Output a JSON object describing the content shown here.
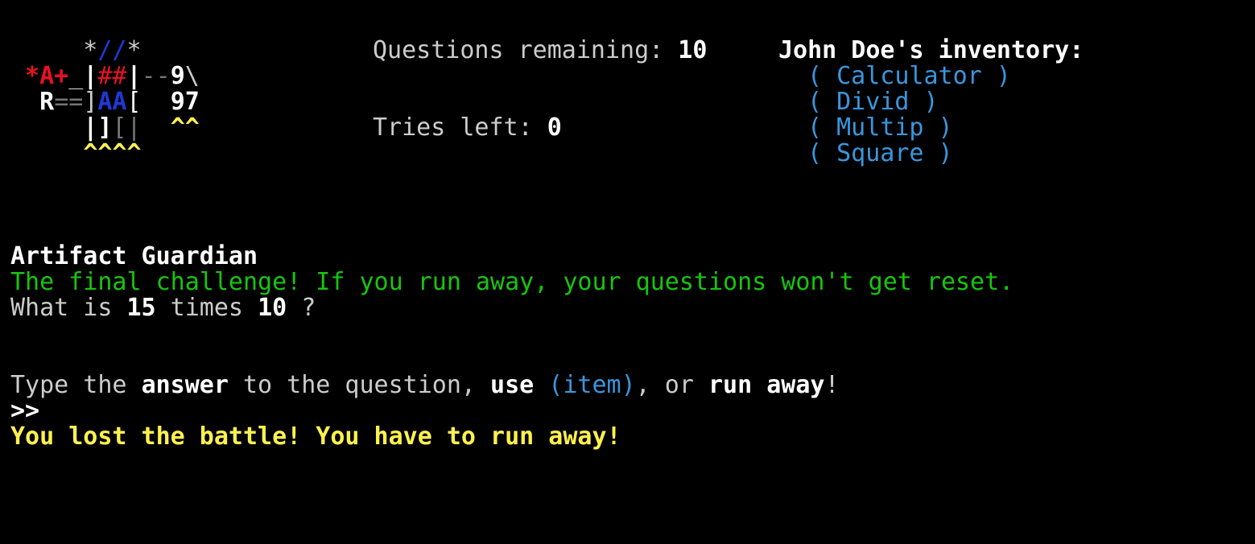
{
  "colors": {
    "background": "#000000",
    "default_text": "#cccccc",
    "bright_text": "#ffffff",
    "red": "#e81123",
    "blue": "#1f39d6",
    "cyan": "#3a96dd",
    "green": "#16c60c",
    "yellow": "#fff14d",
    "dark_grey": "#767676"
  },
  "ascii_art": {
    "row1": {
      "a": "     *",
      "b": "//",
      "c": "*"
    },
    "row2": {
      "a": " *A+",
      "b": "_",
      "c": "|",
      "d": "##",
      "e": "|",
      "f": "--",
      "g": "9",
      "h": "\\"
    },
    "row3": {
      "a": "  R",
      "b": "==",
      "c": "]",
      "d": "AA",
      "e": "[",
      "f": "  ",
      "g": "97"
    },
    "row4": {
      "a": "     ",
      "b": "|]",
      "c": "[|",
      "d": "  ",
      "e": "^^"
    },
    "row5": {
      "a": "     ",
      "b": "^^^^"
    }
  },
  "stats": {
    "questions_label": "Questions remaining: ",
    "questions_value": "10",
    "tries_label": "Tries left: ",
    "tries_value": "0"
  },
  "inventory": {
    "title": "John Doe's inventory:",
    "items": [
      "( Calculator )",
      "( Divid )",
      "( Multip )",
      "( Square )"
    ]
  },
  "enemy": {
    "name": "Artifact Guardian",
    "challenge_text": "The final challenge! If you run away, your questions won't get reset."
  },
  "question": {
    "prefix": "What is ",
    "num1": "15",
    "middle": " times ",
    "num2": "10",
    "suffix": " ?"
  },
  "prompt": {
    "p1": "Type the ",
    "answer": "answer",
    "p2": " to the question, ",
    "use": "use",
    "p3": " ",
    "item": "(item)",
    "p4": ", or ",
    "run_away": "run away",
    "p5": "!",
    "cursor": ">>"
  },
  "result": {
    "message": "You lost the battle! You have to run away!"
  }
}
